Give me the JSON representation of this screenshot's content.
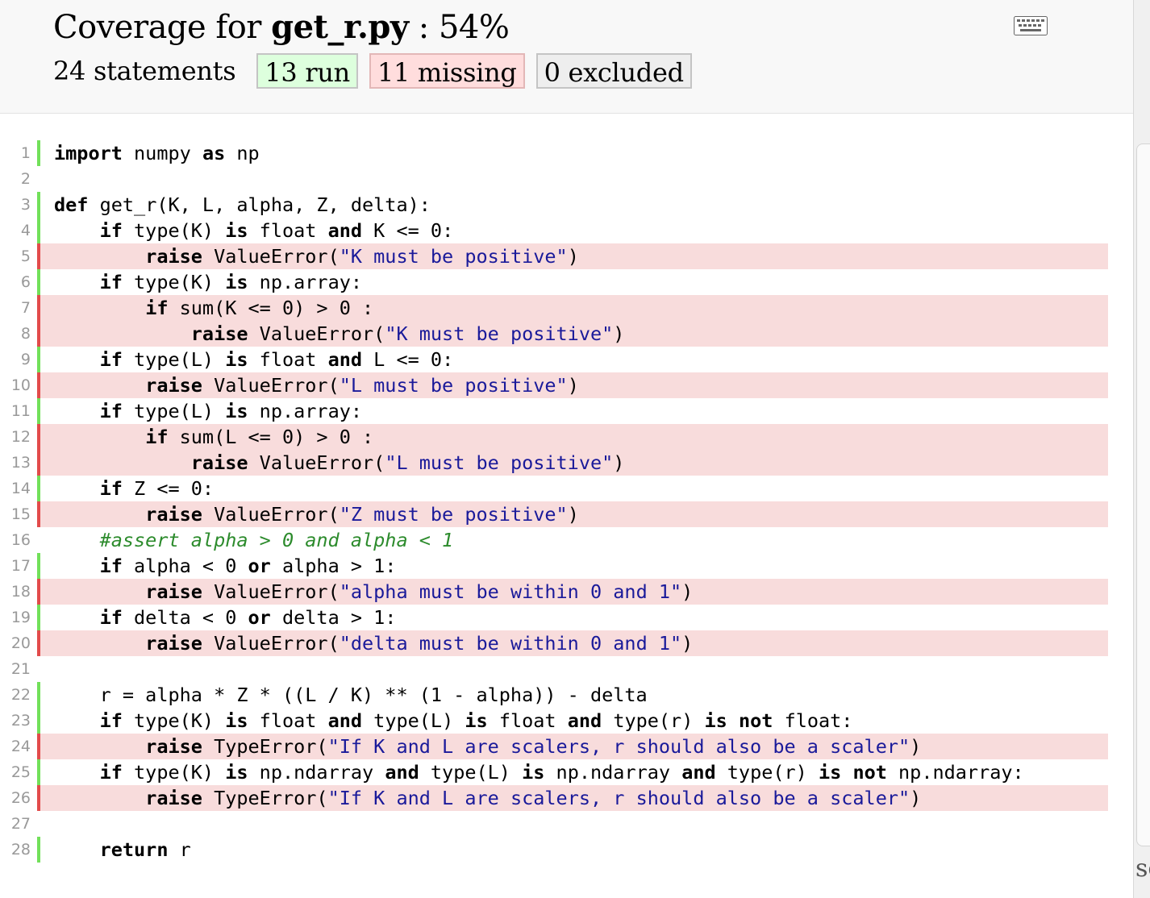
{
  "header": {
    "title_prefix": "Coverage for ",
    "file_name": "get_r.py",
    "title_suffix": " : 54%",
    "statements": "24 statements",
    "run": "13 run",
    "missing": "11 missing",
    "excluded": "0 excluded",
    "icon": "keyboard-icon"
  },
  "colors": {
    "run_marker": "#72e05a",
    "missing_marker": "#e24b4b",
    "missing_background": "#f8dcdc",
    "run_badge": "#ddffdd",
    "missing_badge": "#ffdddd",
    "excluded_badge": "#eeeeee"
  },
  "lines": [
    {
      "n": "1",
      "status": "run",
      "code": "import numpy as np"
    },
    {
      "n": "2",
      "status": "",
      "code": ""
    },
    {
      "n": "3",
      "status": "run",
      "code": "def get_r(K, L, alpha, Z, delta):"
    },
    {
      "n": "4",
      "status": "run",
      "code": "    if type(K) is float and K <= 0:"
    },
    {
      "n": "5",
      "status": "mis",
      "code": "        raise ValueError(\"K must be positive\")"
    },
    {
      "n": "6",
      "status": "run",
      "code": "    if type(K) is np.array:"
    },
    {
      "n": "7",
      "status": "mis",
      "code": "        if sum(K <= 0) > 0 :"
    },
    {
      "n": "8",
      "status": "mis",
      "code": "            raise ValueError(\"K must be positive\")"
    },
    {
      "n": "9",
      "status": "run",
      "code": "    if type(L) is float and L <= 0:"
    },
    {
      "n": "10",
      "status": "mis",
      "code": "        raise ValueError(\"L must be positive\")"
    },
    {
      "n": "11",
      "status": "run",
      "code": "    if type(L) is np.array:"
    },
    {
      "n": "12",
      "status": "mis",
      "code": "        if sum(L <= 0) > 0 :"
    },
    {
      "n": "13",
      "status": "mis",
      "code": "            raise ValueError(\"L must be positive\")"
    },
    {
      "n": "14",
      "status": "run",
      "code": "    if Z <= 0:"
    },
    {
      "n": "15",
      "status": "mis",
      "code": "        raise ValueError(\"Z must be positive\")"
    },
    {
      "n": "16",
      "status": "",
      "code": "    #assert alpha > 0 and alpha < 1"
    },
    {
      "n": "17",
      "status": "run",
      "code": "    if alpha < 0 or alpha > 1:"
    },
    {
      "n": "18",
      "status": "mis",
      "code": "        raise ValueError(\"alpha must be within 0 and 1\")"
    },
    {
      "n": "19",
      "status": "run",
      "code": "    if delta < 0 or delta > 1:"
    },
    {
      "n": "20",
      "status": "mis",
      "code": "        raise ValueError(\"delta must be within 0 and 1\")"
    },
    {
      "n": "21",
      "status": "",
      "code": ""
    },
    {
      "n": "22",
      "status": "run",
      "code": "    r = alpha * Z * ((L / K) ** (1 - alpha)) - delta"
    },
    {
      "n": "23",
      "status": "run",
      "code": "    if type(K) is float and type(L) is float and type(r) is not float:"
    },
    {
      "n": "24",
      "status": "mis",
      "code": "        raise TypeError(\"If K and L are scalers, r should also be a scaler\")"
    },
    {
      "n": "25",
      "status": "run",
      "code": "    if type(K) is np.ndarray and type(L) is np.ndarray and type(r) is not np.ndarray:"
    },
    {
      "n": "26",
      "status": "mis",
      "code": "        raise TypeError(\"If K and L are scalers, r should also be a scaler\")"
    },
    {
      "n": "27",
      "status": "",
      "code": ""
    },
    {
      "n": "28",
      "status": "run",
      "code": "    return r"
    }
  ],
  "edge_text": "se"
}
